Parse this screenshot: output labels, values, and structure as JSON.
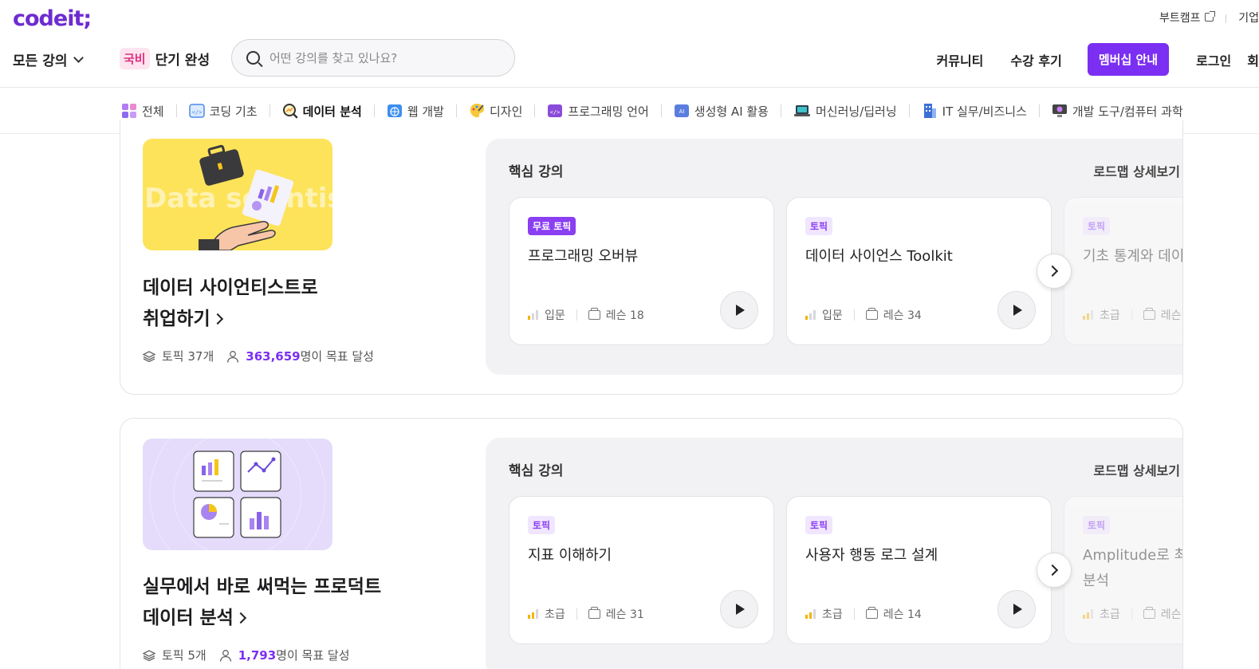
{
  "header": {
    "logo": "codeit;",
    "top_links": [
      "부트캠프",
      "기업"
    ],
    "all_courses": "모든 강의",
    "gukbi_badge": "국비",
    "gukbi_label": "단기 완성",
    "search_placeholder": "어떤 강의를 찾고 있나요?",
    "nav": {
      "community": "커뮤니티",
      "reviews": "수강 후기",
      "membership": "멤버십 안내",
      "login": "로그인",
      "signup": "회"
    },
    "colors": {
      "brand": "#6d2ccf",
      "accent": "#7b2ff2"
    }
  },
  "categories": [
    {
      "label": "전체",
      "icon": "grid-icon",
      "active": false
    },
    {
      "label": "코딩 기초",
      "icon": "code-window-icon",
      "active": false
    },
    {
      "label": "데이터 분석",
      "icon": "magnifier-chart-icon",
      "active": true
    },
    {
      "label": "웹 개발",
      "icon": "globe-icon",
      "active": false
    },
    {
      "label": "디자인",
      "icon": "palette-icon",
      "active": false
    },
    {
      "label": "프로그래밍 언어",
      "icon": "code-tag-icon",
      "active": false
    },
    {
      "label": "생성형 AI 활용",
      "icon": "ai-icon",
      "active": false
    },
    {
      "label": "머신러닝/딥러닝",
      "icon": "laptop-icon",
      "active": false
    },
    {
      "label": "IT 실무/비즈니스",
      "icon": "building-icon",
      "active": false
    },
    {
      "label": "개발 도구/컴퓨터 과학",
      "icon": "monitor-icon",
      "active": false
    }
  ],
  "courses": [
    {
      "title_line1": "데이터 사이언티스트로",
      "title_line2": "취업하기",
      "thumb_text": "Data scientist",
      "topics": "토픽 37개",
      "achievers": "363,659",
      "achievers_suffix": "명이 목표 달성",
      "panel_title": "핵심 강의",
      "roadmap": "로드맵 상세보기",
      "lessons": [
        {
          "tag": "무료 토픽",
          "tag_type": "free",
          "title": "프로그래밍 오버뷰",
          "level": "입문",
          "level_bars": 1,
          "lessons": "레슨 18"
        },
        {
          "tag": "토픽",
          "tag_type": "topic",
          "title": "데이터 사이언스 Toolkit",
          "level": "입문",
          "level_bars": 1,
          "lessons": "레슨 34"
        },
        {
          "tag": "토픽",
          "tag_type": "topic",
          "title": "기초 통계와 데이",
          "level": "초급",
          "level_bars": 2,
          "lessons": "레슨"
        }
      ]
    },
    {
      "title_line1": "실무에서 바로 써먹는 프로덕트",
      "title_line2": "데이터 분석",
      "topics": "토픽 5개",
      "achievers": "1,793",
      "achievers_suffix": "명이 목표 달성",
      "panel_title": "핵심 강의",
      "roadmap": "로드맵 상세보기",
      "lessons": [
        {
          "tag": "토픽",
          "tag_type": "topic",
          "title": "지표 이해하기",
          "level": "초급",
          "level_bars": 2,
          "lessons": "레슨 31"
        },
        {
          "tag": "토픽",
          "tag_type": "topic",
          "title": "사용자 행동 로그 설계",
          "level": "초급",
          "level_bars": 2,
          "lessons": "레슨 14"
        },
        {
          "tag": "토픽",
          "tag_type": "topic",
          "title": "Amplitude로 최",
          "title2": "분석",
          "level": "초급",
          "level_bars": 2,
          "lessons": "레슨"
        }
      ]
    }
  ]
}
